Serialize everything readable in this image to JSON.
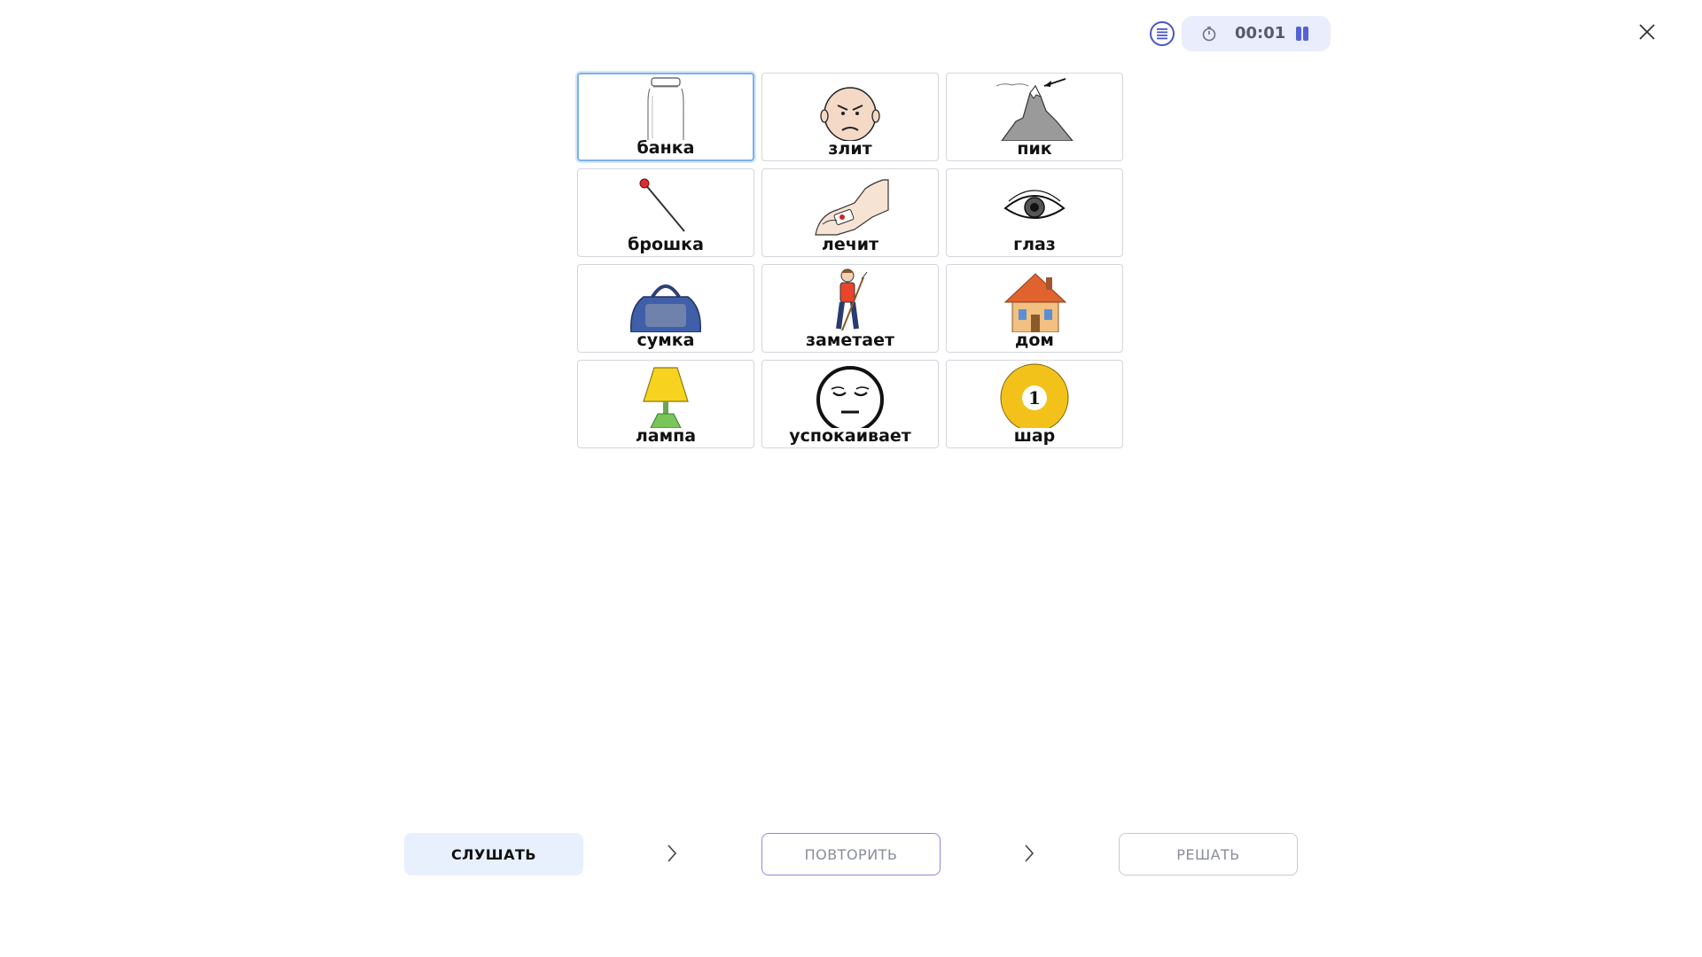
{
  "header": {
    "timer": "00:01",
    "menu_icon": "list-icon",
    "timer_icon": "stopwatch-icon",
    "pause_icon": "pause-icon",
    "close_icon": "close-icon"
  },
  "cards": [
    {
      "label": "банка",
      "icon": "jar-icon",
      "selected": true
    },
    {
      "label": "злит",
      "icon": "angry-face-icon"
    },
    {
      "label": "пик",
      "icon": "mountain-peak-icon"
    },
    {
      "label": "брошка",
      "icon": "pin-icon"
    },
    {
      "label": "лечит",
      "icon": "bandage-icon"
    },
    {
      "label": "глаз",
      "icon": "eye-icon"
    },
    {
      "label": "сумка",
      "icon": "bag-icon"
    },
    {
      "label": "заметает",
      "icon": "sweeping-boy-icon"
    },
    {
      "label": "дом",
      "icon": "house-icon"
    },
    {
      "label": "лампа",
      "icon": "lamp-icon"
    },
    {
      "label": "успокаивает",
      "icon": "calm-face-icon"
    },
    {
      "label": "шар",
      "icon": "billiard-ball-icon",
      "ball_number": "1"
    }
  ],
  "controls": {
    "listen": "СЛУШАТЬ",
    "repeat": "ПОВТОРИТЬ",
    "solve": "РЕШАТЬ"
  },
  "colors": {
    "accent": "#5463d6",
    "selected_border": "#7fb0ea",
    "listen_bg": "#e8f0fe",
    "repeat_border": "#9b83e0"
  }
}
